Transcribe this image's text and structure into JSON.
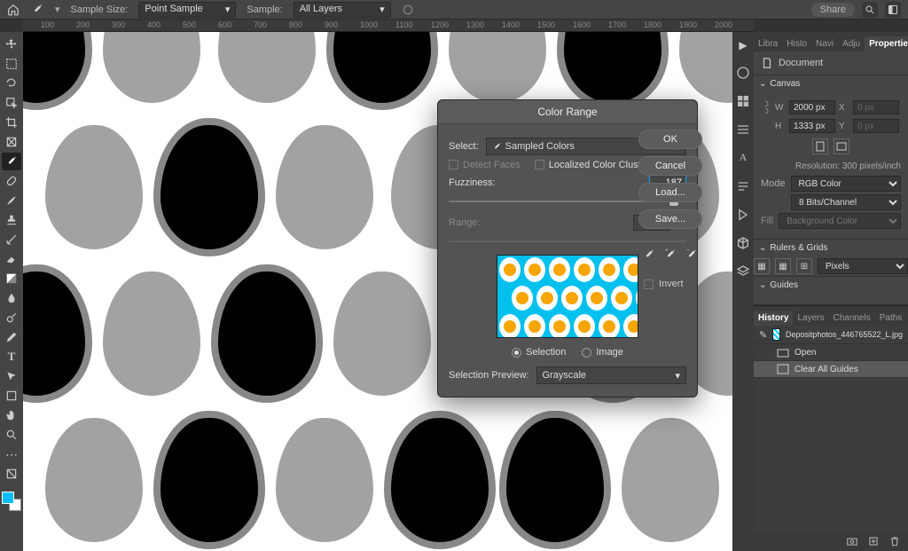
{
  "topbar": {
    "sample_size_label": "Sample Size:",
    "sample_size_value": "Point Sample",
    "sample_label": "Sample:",
    "sample_value": "All Layers",
    "share_label": "Share"
  },
  "ruler_ticks": [
    "100",
    "200",
    "300",
    "400",
    "500",
    "600",
    "700",
    "800",
    "900",
    "1000",
    "1100",
    "1200",
    "1300",
    "1400",
    "1500",
    "1600",
    "1700",
    "1800",
    "1900",
    "2000"
  ],
  "panels": {
    "tabs": [
      "Libra",
      "Histo",
      "Navi",
      "Adju",
      "Properties"
    ],
    "document_label": "Document",
    "canvas_head": "Canvas",
    "w_label": "W",
    "w_value": "2000 px",
    "h_label": "H",
    "h_value": "1333 px",
    "x_label": "X",
    "x_value": "0 px",
    "y_label": "Y",
    "y_value": "0 px",
    "resolution": "Resolution: 300 pixels/inch",
    "mode_label": "Mode",
    "mode_value": "RGB Color",
    "depth_value": "8 Bits/Channel",
    "fill_label": "Fill",
    "fill_value": "Background Color",
    "rulers_head": "Rulers & Grids",
    "units_value": "Pixels",
    "guides_head": "Guides"
  },
  "history": {
    "tabs": [
      "History",
      "Layers",
      "Channels",
      "Paths"
    ],
    "file_name": "Depositphotos_446765522_L.jpg",
    "items": [
      "Open",
      "Clear All Guides"
    ]
  },
  "dialog": {
    "title": "Color Range",
    "select_label": "Select:",
    "select_value": "Sampled Colors",
    "detect_faces": "Detect Faces",
    "localized": "Localized Color Clusters",
    "fuzziness_label": "Fuzziness:",
    "fuzziness_value": "187",
    "range_label": "Range:",
    "range_unit": "%",
    "radio_selection": "Selection",
    "radio_image": "Image",
    "preview_label": "Selection Preview:",
    "preview_value": "Grayscale",
    "ok": "OK",
    "cancel": "Cancel",
    "load": "Load...",
    "save": "Save...",
    "invert": "Invert"
  }
}
